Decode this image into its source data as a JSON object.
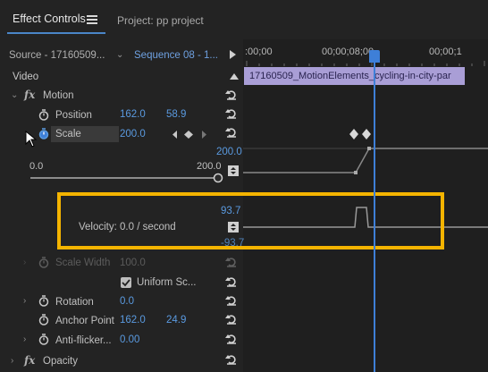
{
  "tabs": {
    "active": "Effect Controls",
    "project": "Project: pp project"
  },
  "source": {
    "label": "Source - 17160509...",
    "sequence": "Sequence 08 - 1..."
  },
  "timeline": {
    "times": [
      ":00;00",
      "00;00;08;00",
      "00;00;1"
    ],
    "clip_name": "17160509_MotionElements_cycling-in-city-par"
  },
  "video_label": "Video",
  "motion": {
    "label": "Motion",
    "position": {
      "label": "Position",
      "x": "162.0",
      "y": "58.9"
    },
    "scale": {
      "label": "Scale",
      "value": "200.0",
      "graph_max": "200.0",
      "slider_min": "0.0",
      "slider_max": "200.0",
      "velocity_max": "93.7",
      "velocity_min": "-93.7",
      "velocity_text": "Velocity: 0.0 / second"
    },
    "scale_width": {
      "label": "Scale Width",
      "value": "100.0"
    },
    "uniform_scale": {
      "label": "Uniform Sc...",
      "checked": true
    },
    "rotation": {
      "label": "Rotation",
      "value": "0.0"
    },
    "anchor_point": {
      "label": "Anchor Point",
      "x": "162.0",
      "y": "24.9"
    },
    "anti_flicker": {
      "label": "Anti-flicker...",
      "value": "0.00"
    }
  },
  "opacity": {
    "label": "Opacity"
  },
  "colors": {
    "accent": "#3e7fd8",
    "highlight": "#f4b400",
    "clip": "#a99ed6",
    "value_blue": "#5a9ae0"
  }
}
